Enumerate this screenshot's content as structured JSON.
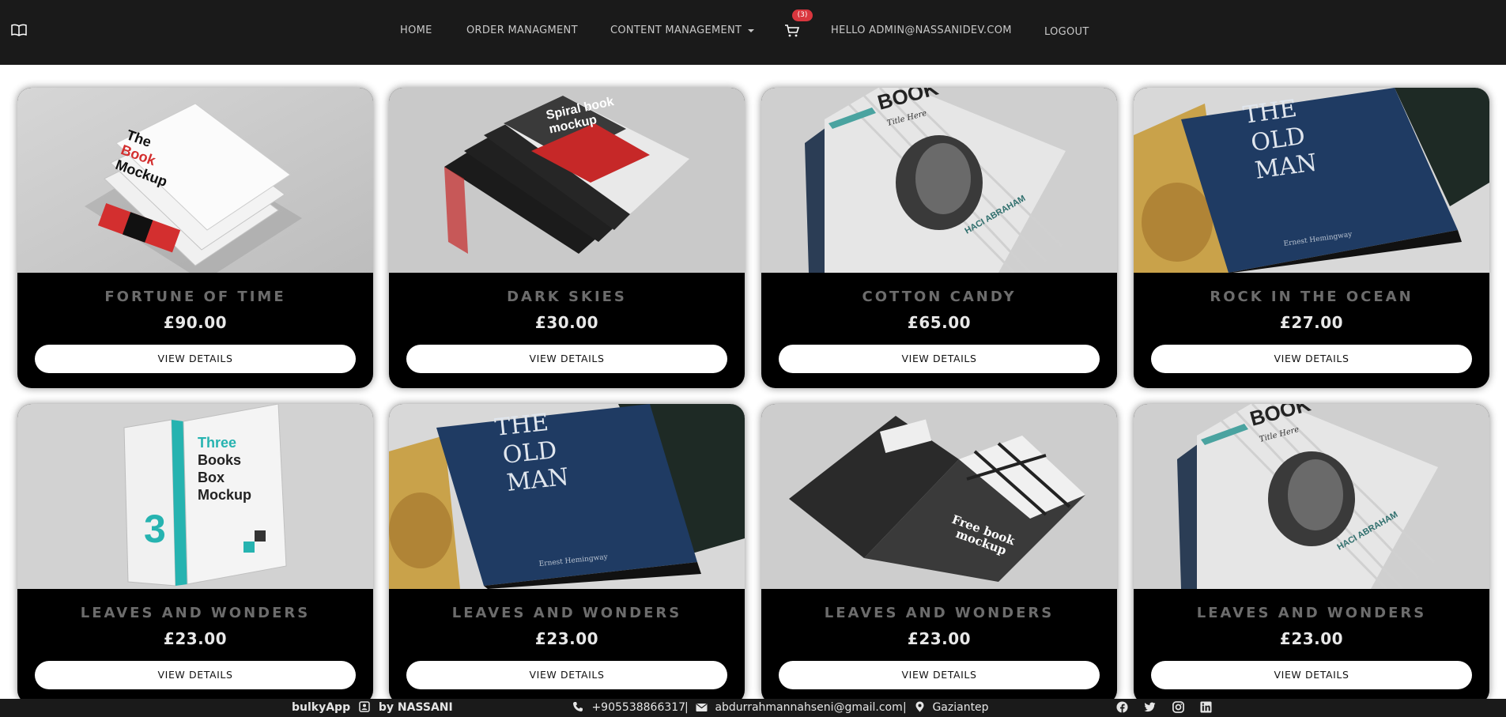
{
  "nav": {
    "home": "HOME",
    "order": "ORDER MANAGMENT",
    "content": "CONTENT MANAGEMENT",
    "cart_count": "(3)",
    "hello": "HELLO ADMIN@NASSANIDEV.COM",
    "logout": "LOGOUT",
    "icons": [
      "book-icon",
      "cart-icon",
      "caret-down-icon"
    ]
  },
  "products": [
    {
      "title": "FORTUNE OF TIME",
      "price": "£90.00",
      "button": "VIEW DETAILS"
    },
    {
      "title": "DARK SKIES",
      "price": "£30.00",
      "button": "VIEW DETAILS"
    },
    {
      "title": "COTTON CANDY",
      "price": "£65.00",
      "button": "VIEW DETAILS"
    },
    {
      "title": "ROCK IN THE OCEAN",
      "price": "£27.00",
      "button": "VIEW DETAILS"
    },
    {
      "title": "LEAVES AND WONDERS",
      "price": "£23.00",
      "button": "VIEW DETAILS"
    },
    {
      "title": "LEAVES AND WONDERS",
      "price": "£23.00",
      "button": "VIEW DETAILS"
    },
    {
      "title": "LEAVES AND WONDERS",
      "price": "£23.00",
      "button": "VIEW DETAILS"
    },
    {
      "title": "LEAVES AND WONDERS",
      "price": "£23.00",
      "button": "VIEW DETAILS"
    }
  ],
  "covers": {
    "p1_line1": "The",
    "p1_line2": "Book",
    "p1_line3": "Mockup",
    "p2_line1": "Spiral book",
    "p2_line2": "mockup",
    "p3_title": "BOOK",
    "p3_sub": "Title Here",
    "p3_author": "HACI ABRAHAM",
    "p4_line1": "THE",
    "p4_line2": "OLD",
    "p4_line3": "MAN",
    "p4_author": "Ernest Hemingway",
    "p5_line1": "Three",
    "p5_line2": "Books",
    "p5_line3": "Box",
    "p5_line4": "Mockup",
    "p5_num": "3",
    "p7_line1": "Free book",
    "p7_line2": "mockup"
  },
  "footer": {
    "app": "bulkyApp",
    "by": "by NASSANI",
    "phone": "+905538866317",
    "sep": "|",
    "email": "abdurrahmannahseni@gmail.com",
    "location": "Gaziantep",
    "social_icons": [
      "facebook-icon",
      "twitter-icon",
      "instagram-icon",
      "linkedin-icon"
    ]
  },
  "colors": {
    "navbar_bg": "#1a1a1a",
    "card_bg": "#000000",
    "title_color": "#6c6c6c",
    "badge_bg": "#d9363e"
  }
}
